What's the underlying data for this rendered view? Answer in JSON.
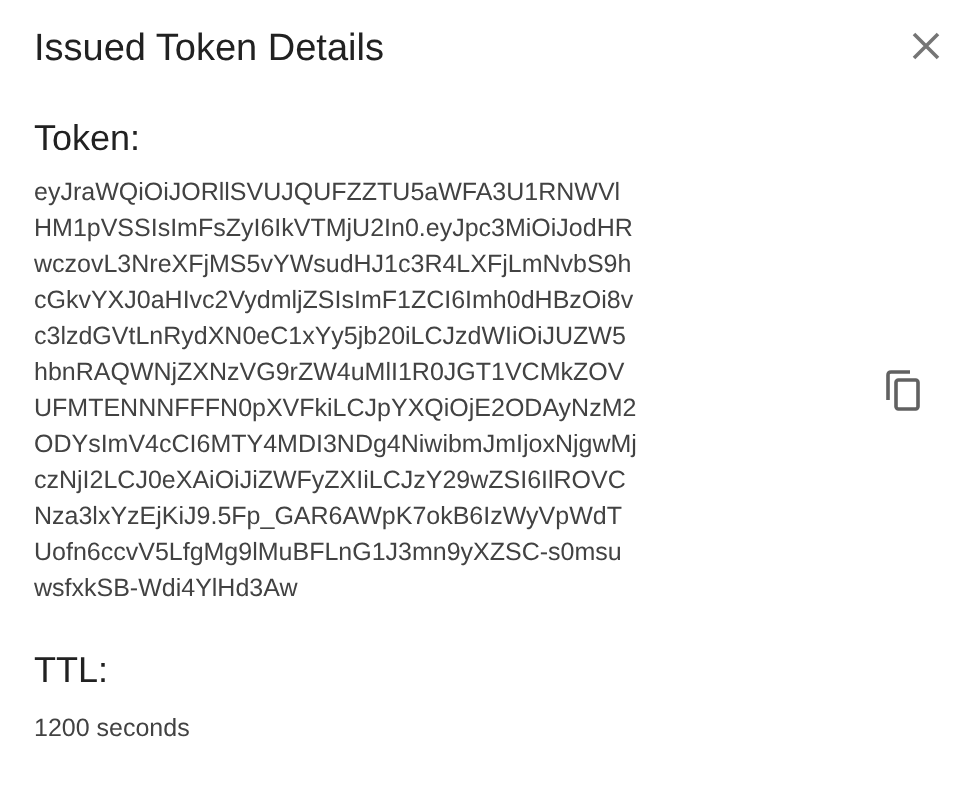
{
  "dialog": {
    "title": "Issued Token Details"
  },
  "token": {
    "label": "Token:",
    "value": "eyJraWQiOiJORllSVUJQUFZZTU5aWFA3U1RNWVlHM1pVSSIsImFsZyI6IkVTMjU2In0.eyJpc3MiOiJodHRwczovL3NreXFjMS5vYWsudHJ1c3R4LXFjLmNvbS9hcGkvYXJ0aHIvc2VydmljZSIsImF1ZCI6Imh0dHBzOi8vc3lzdGVtLnRydXN0eC1xYy5jb20iLCJzdWIiOiJUZW5hbnRAQWNjZXNzVG9rZW4uMlI1R0JGT1VCMkZOVUFMTENNNFFFN0pXVFkiLCJpYXQiOjE2ODAyNzM2ODYsImV4cCI6MTY4MDI3NDg4NiwibmJmIjoxNjgwMjczNjI2LCJ0eXAiOiJiZWFyZXIiLCJzY29wZSI6IlROVCNza3lxYzEjKiJ9.5Fp_GAR6AWpK7okB6IzWyVpWdTUofn6ccvV5LfgMg9lMuBFLnG1J3mn9yXZSC-s0msuwsfxkSB-Wdi4YlHd3Aw"
  },
  "ttl": {
    "label": "TTL:",
    "value": "1200 seconds"
  }
}
